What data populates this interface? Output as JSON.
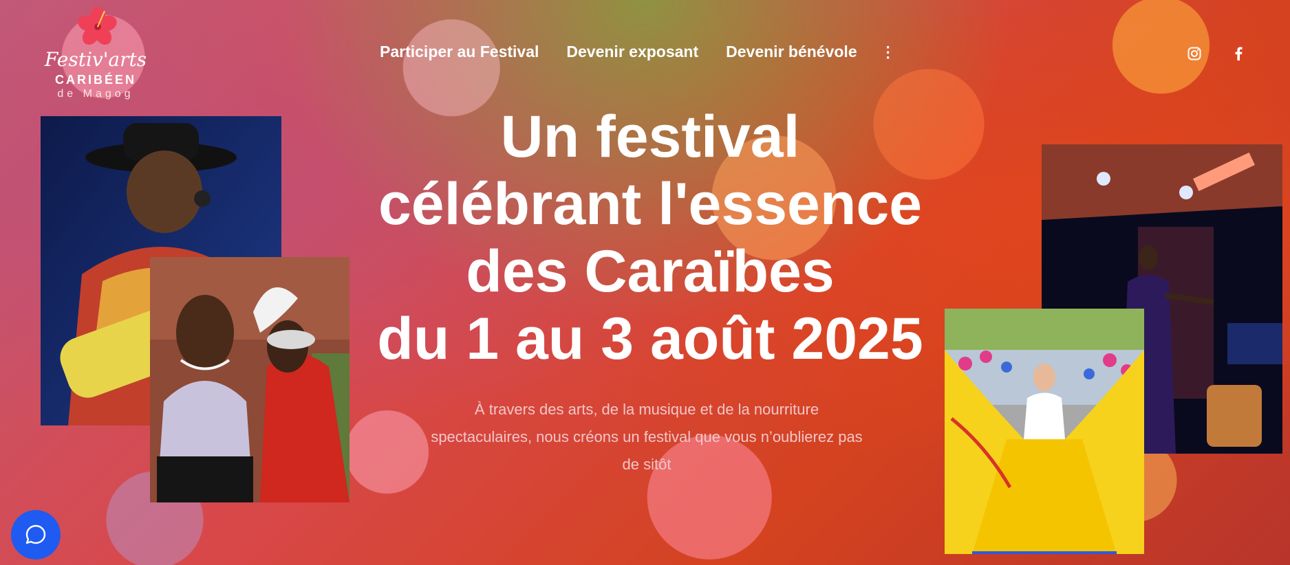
{
  "logo": {
    "line1": "Festiv'arts",
    "line2": "CARIBÉEN",
    "line3": "de Magog",
    "icon": "hibiscus-flower"
  },
  "nav": {
    "items": [
      {
        "label": "Participer au Festival"
      },
      {
        "label": "Devenir exposant"
      },
      {
        "label": "Devenir bénévole"
      }
    ],
    "more_label": "⋮"
  },
  "social": {
    "instagram_icon": "instagram-icon",
    "facebook_icon": "facebook-icon"
  },
  "hero": {
    "title_lines": [
      "Un festival",
      "célébrant l'essence",
      "des Caraïbes",
      "du 1 au 3 août 2025"
    ],
    "subtitle": "À travers des arts, de la musique et de la nourriture spectaculaires, nous créons un festival que vous n’oublierez pas de sitôt"
  },
  "chat": {
    "icon": "chat-bubble-icon"
  },
  "colors": {
    "accent_blue": "#1f5bf0",
    "text_white": "#ffffff",
    "subtitle_pink": "#f2c6c9"
  }
}
